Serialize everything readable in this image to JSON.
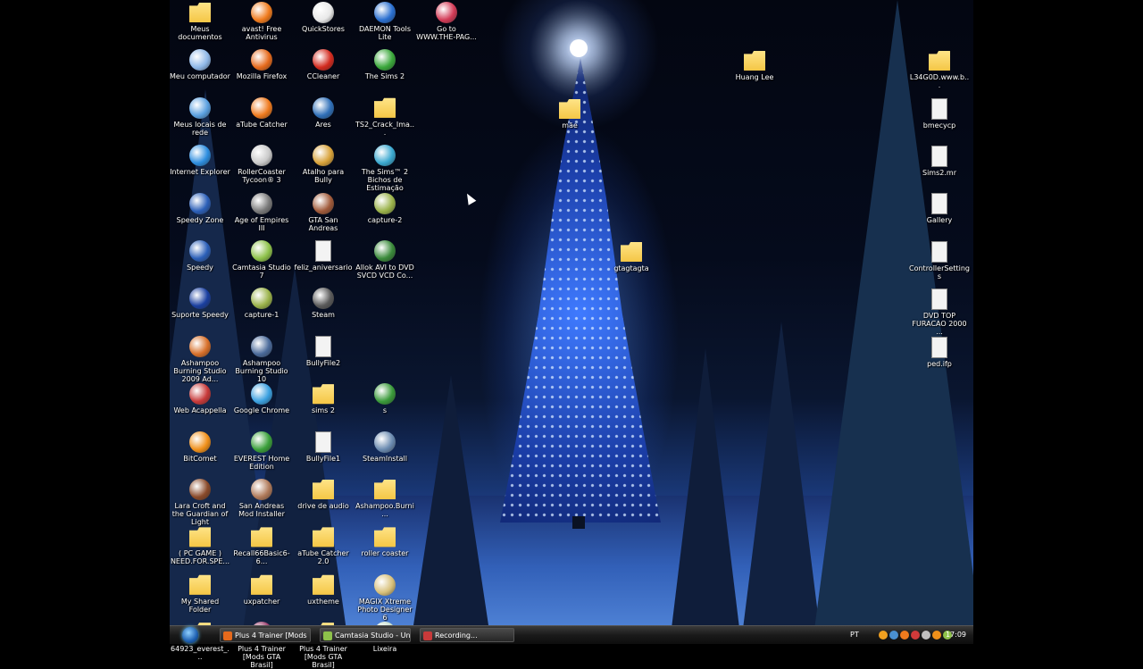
{
  "desktop": {
    "icons": [
      {
        "label": "Meus documentos",
        "icon": "folder-docs-icon",
        "color": "#ffd35a"
      },
      {
        "label": "avast! Free Antivirus",
        "icon": "avast-icon",
        "color": "#f07b1d"
      },
      {
        "label": "QuickStores",
        "icon": "quickstores-icon",
        "color": "#e8e8e8"
      },
      {
        "label": "DAEMON Tools Lite",
        "icon": "daemon-tools-icon",
        "color": "#2a6fd0"
      },
      {
        "label": "Go to WWW.THE-PAG...",
        "icon": "shortcut-icon",
        "color": "#d33b57"
      },
      {
        "label": "Meu computador",
        "icon": "computer-icon",
        "color": "#8fb8e8"
      },
      {
        "label": "Mozilla Firefox",
        "icon": "firefox-icon",
        "color": "#e66a1c"
      },
      {
        "label": "CCleaner",
        "icon": "ccleaner-icon",
        "color": "#d32a1e"
      },
      {
        "label": "The Sims 2",
        "icon": "sims-icon",
        "color": "#3aa83a"
      },
      {
        "label": "Meus locais de rede",
        "icon": "network-icon",
        "color": "#5aa0e0"
      },
      {
        "label": "aTube Catcher",
        "icon": "atube-icon",
        "color": "#ef7a1e"
      },
      {
        "label": "Ares",
        "icon": "ares-icon",
        "color": "#2f6fb8"
      },
      {
        "label": "TS2_Crack_Ima...",
        "icon": "folder-icon",
        "color": "#ffd35a"
      },
      {
        "label": "Internet Explorer",
        "icon": "ie-icon",
        "color": "#2d8ee0"
      },
      {
        "label": "RollerCoaster Tycoon® 3",
        "icon": "rct3-icon",
        "color": "#c9c9c9"
      },
      {
        "label": "Atalho para Bully",
        "icon": "bully-icon",
        "color": "#d8a23a"
      },
      {
        "label": "The Sims™ 2 Bichos de Estimação",
        "icon": "sims-pets-icon",
        "color": "#3aa8d0"
      },
      {
        "label": "Speedy Zone",
        "icon": "speedy-zone-icon",
        "color": "#2b5fb8"
      },
      {
        "label": "Age of Empires III",
        "icon": "aoe3-icon",
        "color": "#7a7a7a"
      },
      {
        "label": "GTA San Andreas",
        "icon": "gta-sa-icon",
        "color": "#a05a3a"
      },
      {
        "label": "capture-2",
        "icon": "capture-icon",
        "color": "#9ab24a"
      },
      {
        "label": "Speedy",
        "icon": "speedy-icon",
        "color": "#2b5fb8"
      },
      {
        "label": "Camtasia Studio 7",
        "icon": "camtasia-icon",
        "color": "#8ec24a"
      },
      {
        "label": "feliz_aniversario",
        "icon": "document-icon",
        "color": "#f0f0f0"
      },
      {
        "label": "Allok AVI to DVD SVCD VCD Co...",
        "icon": "allok-icon",
        "color": "#3a8a3a"
      },
      {
        "label": "Suporte Speedy",
        "icon": "suporte-speedy-icon",
        "color": "#1a3fa0"
      },
      {
        "label": "capture-1",
        "icon": "capture-icon",
        "color": "#9ab24a"
      },
      {
        "label": "Steam",
        "icon": "steam-icon",
        "color": "#5a5a5a"
      },
      {
        "label": "Ashampoo Burning Studio 2009 Ad...",
        "icon": "ashampoo-icon",
        "color": "#d8702a"
      },
      {
        "label": "Ashampoo Burning Studio 10",
        "icon": "ashampoo-icon",
        "color": "#4a6a9a"
      },
      {
        "label": "BullyFile2",
        "icon": "document-icon",
        "color": "#f0f0f0"
      },
      {
        "label": "Web Acappella",
        "icon": "web-acappella-icon",
        "color": "#c83a3a"
      },
      {
        "label": "Google Chrome",
        "icon": "chrome-icon",
        "color": "#3aa0e0"
      },
      {
        "label": "sims 2",
        "icon": "folder-icon",
        "color": "#ffd35a"
      },
      {
        "label": "s",
        "icon": "media-icon",
        "color": "#3a9a3a"
      },
      {
        "label": "BitComet",
        "icon": "bitcomet-icon",
        "color": "#f0901a"
      },
      {
        "label": "EVEREST Home Edition",
        "icon": "everest-icon",
        "color": "#3aa03a"
      },
      {
        "label": "BullyFile1",
        "icon": "document-icon",
        "color": "#f0f0f0"
      },
      {
        "label": "SteamInstall",
        "icon": "installer-icon",
        "color": "#6a8ab0"
      },
      {
        "label": "Lara Croft and the Guardian of Light",
        "icon": "lara-croft-icon",
        "color": "#8a4a2a"
      },
      {
        "label": "San Andreas Mod Installer",
        "icon": "sa-mod-icon",
        "color": "#b07a5a"
      },
      {
        "label": "drive de audio",
        "icon": "folder-icon",
        "color": "#ffd35a"
      },
      {
        "label": "Ashampoo.Burni...",
        "icon": "folder-icon",
        "color": "#ffd35a"
      },
      {
        "label": "( PC GAME ) NEED.FOR.SPE...",
        "icon": "folder-icon",
        "color": "#ffd35a"
      },
      {
        "label": "Recall66Basic6-6...",
        "icon": "folder-icon",
        "color": "#ffd35a"
      },
      {
        "label": "aTube Catcher 2.0",
        "icon": "folder-icon",
        "color": "#ffd35a"
      },
      {
        "label": "roller coaster",
        "icon": "folder-icon",
        "color": "#ffd35a"
      },
      {
        "label": "My Shared Folder",
        "icon": "folder-icon",
        "color": "#ffd35a"
      },
      {
        "label": "uxpatcher",
        "icon": "folder-icon",
        "color": "#ffd35a"
      },
      {
        "label": "uxtheme",
        "icon": "folder-icon",
        "color": "#ffd35a"
      },
      {
        "label": "MAGIX Xtreme Photo Designer 6",
        "icon": "magix-icon",
        "color": "#d8c07a"
      },
      {
        "label": "64923_everest_...",
        "icon": "folder-icon",
        "color": "#ffd35a"
      },
      {
        "label": "Plus 4 Trainer [Mods GTA Brasil]",
        "icon": "winrar-icon",
        "color": "#9a3a6a"
      },
      {
        "label": "Plus 4 Trainer [Mods GTA Brasil]",
        "icon": "folder-icon",
        "color": "#ffd35a"
      },
      {
        "label": "Lixeira",
        "icon": "recycle-bin-icon",
        "color": "#c8e0d0"
      },
      {
        "label": "mãe",
        "icon": "folder-icon",
        "color": "#ffd35a"
      },
      {
        "label": "gtagtagta",
        "icon": "folder-icon",
        "color": "#ffd35a"
      },
      {
        "label": "Huang Lee",
        "icon": "folder-icon",
        "color": "#ffd35a"
      },
      {
        "label": "L34G0D.www.b...",
        "icon": "folder-icon",
        "color": "#ffd35a"
      },
      {
        "label": "bmecycp",
        "icon": "document-icon",
        "color": "#f0f0f0"
      },
      {
        "label": "Sims2.mr",
        "icon": "document-icon",
        "color": "#f0f0f0"
      },
      {
        "label": "Gallery",
        "icon": "document-icon",
        "color": "#f0f0f0"
      },
      {
        "label": "ControllerSettings",
        "icon": "document-icon",
        "color": "#f0f0f0"
      },
      {
        "label": "DVD TOP FURACAO 2000 ...",
        "icon": "document-icon",
        "color": "#f0f0f0"
      },
      {
        "label": "ped.ifp",
        "icon": "document-icon",
        "color": "#f0f0f0"
      }
    ]
  },
  "taskbar": {
    "start_icon": "windows-start-icon",
    "items": [
      {
        "label": "Plus 4 Trainer [Mods ...",
        "icon": "firefox-icon",
        "color": "#e66a1c"
      },
      {
        "label": "Camtasia Studio - Un...",
        "icon": "camtasia-icon",
        "color": "#8ec24a"
      },
      {
        "label": "Recording...",
        "icon": "recording-icon",
        "color": "#c83a3a"
      }
    ],
    "language": "PT",
    "tray_icons": [
      {
        "icon": "tray-orange-icon",
        "color": "#f0a020"
      },
      {
        "icon": "tray-network-icon",
        "color": "#4a90d0"
      },
      {
        "icon": "tray-avast-icon",
        "color": "#f07b1d"
      },
      {
        "icon": "tray-shield-icon",
        "color": "#d03a3a"
      },
      {
        "icon": "tray-speaker-icon",
        "color": "#c0c0c0"
      },
      {
        "icon": "tray-bitcomet-icon",
        "color": "#f0901a"
      },
      {
        "icon": "tray-camtasia-icon",
        "color": "#8ec24a"
      }
    ],
    "clock": "17:09"
  }
}
